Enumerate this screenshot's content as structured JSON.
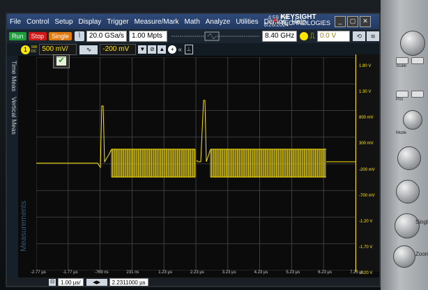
{
  "menu": [
    "File",
    "Control",
    "Setup",
    "Display",
    "Trigger",
    "Measure/Mark",
    "Math",
    "Analyze",
    "Utilities",
    "Demos",
    "Help"
  ],
  "clock": {
    "time": "4:59 PM",
    "date": "8/26/2024"
  },
  "brand": {
    "name": "KEYSIGHT",
    "sub": "TECHNOLOGIES"
  },
  "toolbar": {
    "run": "Run",
    "stop": "Stop",
    "single": "Single",
    "sample_rate": "20.0 GSa/s",
    "memory": "1.00 Mpts",
    "bandwidth": "8.40 GHz",
    "trigger_level": "0.0 V"
  },
  "channel": {
    "coupling_top": "500",
    "coupling_bottom": "DC",
    "scale": "500 mV/",
    "offset": "-200 mV"
  },
  "side_tabs": {
    "time": "Time Meas",
    "vertical": "Vertical Meas",
    "measurements": "Measurements"
  },
  "right_scale": [
    "1.80 V",
    "1.30 V",
    "800 mV",
    "300 mV",
    "-200 mV",
    "-700 mV",
    "-1.20 V",
    "-1.70 V",
    "-2.20 V"
  ],
  "bottom_axis": [
    "-2.77 µs",
    "-1.77 µs",
    "-769 ns",
    "231 ns",
    "1.23 µs",
    "2.23 µs",
    "3.23 µs",
    "4.23 µs",
    "5.23 µs",
    "6.23 µs",
    "7.23 µs"
  ],
  "status": {
    "timebase": "1.00 µs/",
    "delay": "2.2311000 µs"
  },
  "colors": {
    "trace": "#ffe600",
    "grid": "#4a4a4a",
    "menubar": "#2f4a7a",
    "run": "#1e9e3a",
    "stop": "#d01818",
    "single": "#e07a10"
  },
  "panel_labels": [
    "Scale",
    "Pos",
    "Mode",
    "Single",
    "Zoom"
  ]
}
